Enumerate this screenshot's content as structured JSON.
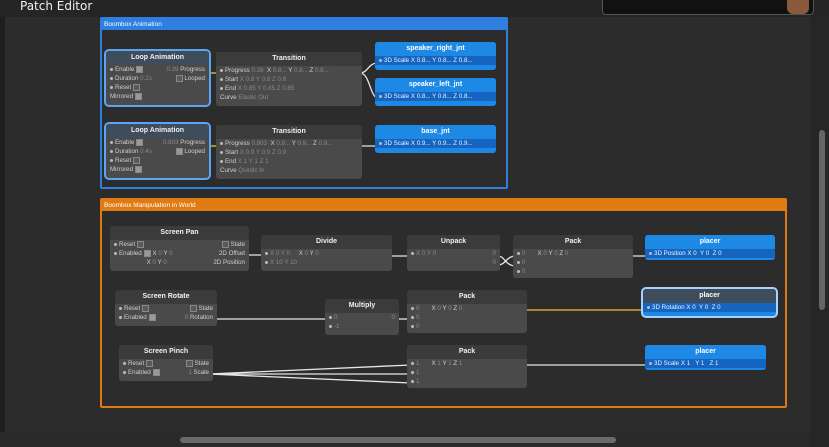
{
  "window": {
    "title": "Patch Editor"
  },
  "groups": {
    "animation": {
      "label": "Boombox Animation"
    },
    "manipulation": {
      "label": "Boombox Manipulation in World"
    }
  },
  "loop1": {
    "title": "Loop Animation",
    "enable": "Enable",
    "progress": "Progress",
    "progress_val": "0.39",
    "duration": "Duration",
    "duration_val": "0.2s",
    "looped": "Looped",
    "reset": "Reset",
    "mirrored": "Mirrored"
  },
  "loop2": {
    "title": "Loop Animation",
    "enable": "Enable",
    "progress": "Progress",
    "progress_val": "0.803",
    "duration": "Duration",
    "duration_val": "0.4s",
    "looped": "Looped",
    "reset": "Reset",
    "mirrored": "Mirrored"
  },
  "trans1": {
    "title": "Transition",
    "progress": "Progress",
    "progress_val": "0.39",
    "x": "X",
    "x_val": "0.8...",
    "y": "Y",
    "y_val": "0.8...",
    "z": "Z",
    "z_val": "0.8...",
    "start": "Start",
    "start_x": "X 0.8",
    "start_y": "Y 0.8",
    "start_z": "Z 0.8",
    "end": "End",
    "end_x": "X 0.85",
    "end_y": "Y 0.85",
    "end_z": "Z 0.85",
    "curve": "Curve",
    "curve_val": "Elastic Out"
  },
  "trans2": {
    "title": "Transition",
    "progress": "Progress",
    "progress_val": "0.803",
    "x": "X",
    "x_val": "0.9...",
    "y": "Y",
    "y_val": "0.9...",
    "z": "Z",
    "z_val": "0.9...",
    "start": "Start",
    "start_x": "X 0.9",
    "start_y": "Y 0.9",
    "start_z": "Z 0.9",
    "end": "End",
    "end_x": "X 1",
    "end_y": "Y 1",
    "end_z": "Z 1",
    "curve": "Curve",
    "curve_val": "Quintic In"
  },
  "speaker_right": {
    "title": "speaker_right_jnt",
    "label": "3D Scale",
    "x": "X 0.8...",
    "y": "Y 0.8...",
    "z": "Z 0.8..."
  },
  "speaker_left": {
    "title": "speaker_left_jnt",
    "label": "3D Scale",
    "x": "X 0.8...",
    "y": "Y 0.8...",
    "z": "Z 0.8..."
  },
  "base": {
    "title": "base_jnt",
    "label": "3D Scale",
    "x": "X 0.9...",
    "y": "Y 0.9...",
    "z": "Z 0.9..."
  },
  "pan": {
    "title": "Screen Pan",
    "reset": "Reset",
    "state": "State",
    "enabled": "Enabled",
    "x": "X",
    "x_val": "0",
    "y": "Y",
    "y_val": "0",
    "offset": "2D Offset",
    "x2": "X",
    "x2_val": "0",
    "y2": "Y",
    "y2_val": "0",
    "position": "2D Position"
  },
  "divide": {
    "title": "Divide",
    "r1": "X 0",
    "r1b": "Y 0",
    "r2": "X 10",
    "r2b": "Y 10",
    "ox": "X",
    "ox_val": "0",
    "oy": "Y",
    "oy_val": "0"
  },
  "unpack": {
    "title": "Unpack",
    "in": "X 0",
    "in_b": "Y 0",
    "o1": "0",
    "o2": "0"
  },
  "pack1": {
    "title": "Pack",
    "x": "X",
    "x_val": "0",
    "y": "Y",
    "y_val": "0",
    "z": "Z",
    "z_val": "0",
    "i1": "0",
    "i2": "0",
    "i3": "0"
  },
  "placer1": {
    "title": "placer",
    "label": "3D Position",
    "x": "X 0",
    "y": "Y 0",
    "z": "Z 0"
  },
  "rotate": {
    "title": "Screen Rotate",
    "reset": "Reset",
    "state": "State",
    "enabled": "Enabled",
    "rotation": "Rotation",
    "rot_val": "0"
  },
  "multiply": {
    "title": "Multiply",
    "i1": "0",
    "i2": "-1",
    "out": "0"
  },
  "pack2": {
    "title": "Pack",
    "x": "X",
    "x_val": "0",
    "y": "Y",
    "y_val": "0",
    "z": "Z",
    "z_val": "0",
    "i1": "0",
    "i2": "0",
    "i3": "0"
  },
  "placer2": {
    "title": "placer",
    "label": "3D Rotation",
    "x": "X 0",
    "y": "Y 0",
    "z": "Z 0"
  },
  "pinch": {
    "title": "Screen Pinch",
    "reset": "Reset",
    "state": "State",
    "enabled": "Enabled",
    "scale": "Scale",
    "scale_val": "1"
  },
  "pack3": {
    "title": "Pack",
    "x": "X",
    "x_val": "1",
    "y": "Y",
    "y_val": "1",
    "z": "Z",
    "z_val": "1",
    "i1": "1",
    "i2": "1",
    "i3": "1"
  },
  "placer3": {
    "title": "placer",
    "label": "3D Scale",
    "x": "X 1",
    "y": "Y 1",
    "z": "Z 1"
  },
  "colors": {
    "animation_group": "#2f7fe0",
    "manipulation_group": "#e07b14",
    "wire_yellow": "#f2c230",
    "wire_white": "#e6e6e6",
    "blue_node": "#1e88e5"
  }
}
